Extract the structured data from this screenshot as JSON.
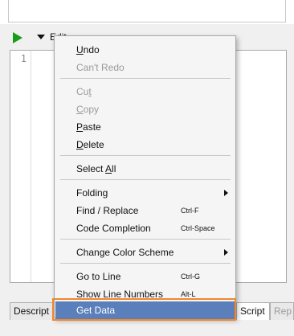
{
  "toolbar": {
    "run_icon": "play-icon",
    "run_color": "#1a9c1a",
    "edit_label": "Edit"
  },
  "editor": {
    "line_numbers": [
      "1"
    ]
  },
  "tabs": {
    "description": "Descript",
    "script": "Script",
    "rep": "Rep"
  },
  "menu": {
    "highlight_color": "#5b7fba",
    "frame_color": "#f0882a",
    "items": [
      {
        "label": "Undo",
        "mnemonic": "U",
        "rest": "ndo",
        "enabled": true
      },
      {
        "label": "Can't Redo",
        "mnemonic": "",
        "rest": "Can't Redo",
        "enabled": false
      },
      {
        "label": "Cut",
        "mnemonic": "",
        "pre": "Cu",
        "u": "t",
        "enabled": false
      },
      {
        "label": "Copy",
        "pre": "",
        "u": "C",
        "post": "opy",
        "enabled": false
      },
      {
        "label": "Paste",
        "pre": "",
        "u": "P",
        "post": "aste",
        "enabled": true
      },
      {
        "label": "Delete",
        "pre": "",
        "u": "D",
        "post": "elete",
        "enabled": true
      },
      {
        "label": "Select All",
        "pre": "Select ",
        "u": "A",
        "post": "ll",
        "enabled": true
      },
      {
        "label": "Folding",
        "submenu": true,
        "enabled": true
      },
      {
        "label": "Find / Replace",
        "shortcut": "Ctrl-F",
        "enabled": true
      },
      {
        "label": "Code Completion",
        "shortcut": "Ctrl-Space",
        "enabled": true
      },
      {
        "label": "Change Color Scheme",
        "submenu": true,
        "enabled": true
      },
      {
        "label": "Go to Line",
        "shortcut": "Ctrl-G",
        "enabled": true
      },
      {
        "label": "Show Line Numbers",
        "shortcut": "Alt-L",
        "enabled": true
      },
      {
        "label": "Get Data",
        "enabled": true,
        "highlighted": true
      }
    ]
  }
}
